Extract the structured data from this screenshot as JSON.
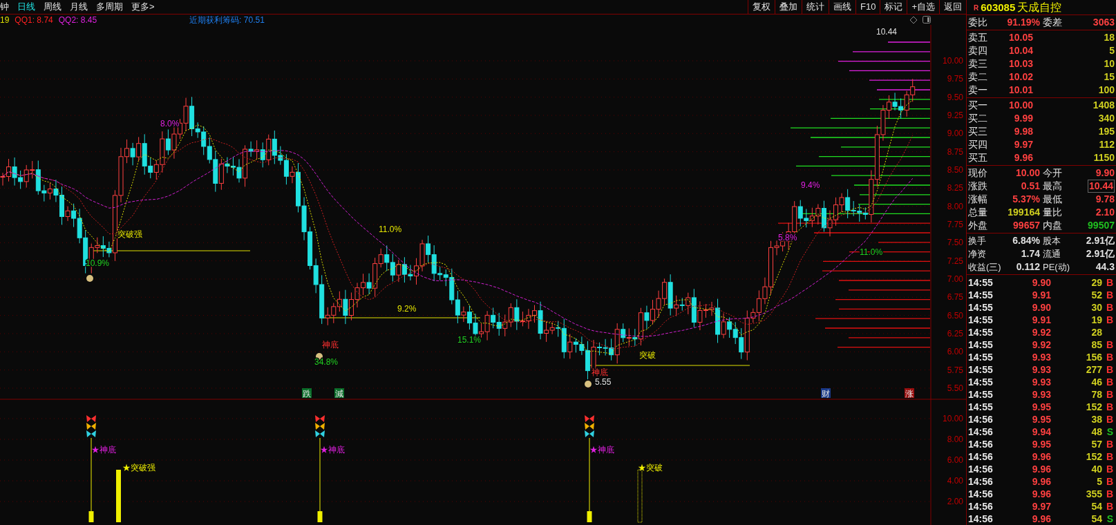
{
  "toolbar": {
    "period_tabs": [
      {
        "label": "钟",
        "selected": false
      },
      {
        "label": "日线",
        "selected": true
      },
      {
        "label": "周线",
        "selected": false
      },
      {
        "label": "月线",
        "selected": false
      },
      {
        "label": "多周期",
        "selected": false
      },
      {
        "label": "更多>",
        "selected": false
      }
    ],
    "buttons": [
      "复权",
      "叠加",
      "统计",
      "画线",
      "F10",
      "标记",
      "+自选",
      "返回"
    ]
  },
  "legend": [
    {
      "text": "19",
      "color": "#e0e000"
    },
    {
      "text": "QQ1: 8.74",
      "color": "#ff2020"
    },
    {
      "text": "QQ2: 8.45",
      "color": "#e020e0"
    },
    {
      "text": "近期获利筹码: 70.51",
      "color": "#1e7ff0"
    }
  ],
  "main_chart": {
    "y_ticks": [
      "10.00",
      "9.75",
      "9.50",
      "9.25",
      "9.00",
      "8.75",
      "8.50",
      "8.25",
      "8.00",
      "7.75",
      "7.50",
      "7.25",
      "7.00",
      "6.75",
      "6.50",
      "6.25",
      "6.00",
      "5.75",
      "5.50"
    ],
    "annotations": [
      {
        "text": "8.0%",
        "color": "#e020e0"
      },
      {
        "text": "突破强",
        "color": "#e8e800"
      },
      {
        "text": "10.9%",
        "color": "#20d020"
      },
      {
        "text": "11.0%",
        "color": "#e8e800"
      },
      {
        "text": "9.2%",
        "color": "#e8e800"
      },
      {
        "text": "15.1%",
        "color": "#20d020"
      },
      {
        "text": "神底",
        "color": "#ff3030"
      },
      {
        "text": "34.8%",
        "color": "#20d020"
      },
      {
        "text": "突破",
        "color": "#e8e800"
      },
      {
        "text": "神底",
        "color": "#ff3030"
      },
      {
        "text": "5.55",
        "color": "#e0e0e0"
      },
      {
        "text": "5.8%",
        "color": "#e020e0"
      },
      {
        "text": "9.4%",
        "color": "#e020e0"
      },
      {
        "text": "11.0%",
        "color": "#20d020"
      },
      {
        "text": "10.44",
        "color": "#e0e0e0"
      }
    ],
    "markers": [
      {
        "text": "跌",
        "color": "#0a6e2a"
      },
      {
        "text": "減",
        "color": "#0a6e2a"
      },
      {
        "text": "财",
        "color": "#1a3a8a"
      },
      {
        "text": "涨",
        "color": "#9a1010"
      }
    ]
  },
  "indicator_pane": {
    "y_ticks": [
      "10.00",
      "8.00",
      "6.00",
      "4.00",
      "2.00"
    ],
    "signals": [
      {
        "kind": "bottom",
        "label": "★神底",
        "color": "#e020e0"
      },
      {
        "kind": "solid_bar",
        "label": "★突破强",
        "color": "#f0f000"
      },
      {
        "kind": "bottom",
        "label": "★神底",
        "color": "#e020e0"
      },
      {
        "kind": "bottom",
        "label": "★神底",
        "color": "#e020e0"
      },
      {
        "kind": "dotted_bar",
        "label": "★突破",
        "color": "#f0f000"
      }
    ]
  },
  "quote_panel": {
    "badge": "R",
    "code": "603085",
    "name": "天成自控",
    "ratio": [
      {
        "label": "委比",
        "value": "91.19%"
      },
      {
        "label": "委差",
        "value": "3063"
      }
    ],
    "asks": [
      {
        "label": "卖五",
        "price": "10.05",
        "volume": "18"
      },
      {
        "label": "卖四",
        "price": "10.04",
        "volume": "5"
      },
      {
        "label": "卖三",
        "price": "10.03",
        "volume": "10"
      },
      {
        "label": "卖二",
        "price": "10.02",
        "volume": "15"
      },
      {
        "label": "卖一",
        "price": "10.01",
        "volume": "100"
      }
    ],
    "bids": [
      {
        "label": "买一",
        "price": "10.00",
        "volume": "1408"
      },
      {
        "label": "买二",
        "price": "9.99",
        "volume": "340"
      },
      {
        "label": "买三",
        "price": "9.98",
        "volume": "195"
      },
      {
        "label": "买四",
        "price": "9.97",
        "volume": "112"
      },
      {
        "label": "买五",
        "price": "9.96",
        "volume": "1150"
      }
    ],
    "stats": [
      [
        {
          "label": "现价",
          "value": "10.00",
          "color": "#ff4040",
          "highlighted": false
        },
        {
          "label": "今开",
          "value": "9.90",
          "color": "#ff4040",
          "highlighted": false
        }
      ],
      [
        {
          "label": "涨跌",
          "value": "0.51",
          "color": "#ff4040",
          "highlighted": false
        },
        {
          "label": "最高",
          "value": "10.44",
          "color": "#ff4040",
          "highlighted": true
        }
      ],
      [
        {
          "label": "涨幅",
          "value": "5.37%",
          "color": "#ff4040",
          "highlighted": false
        },
        {
          "label": "最低",
          "value": "9.78",
          "color": "#ff4040",
          "highlighted": false
        }
      ],
      [
        {
          "label": "总量",
          "value": "199164",
          "color": "#d0d020",
          "highlighted": false
        },
        {
          "label": "量比",
          "value": "2.10",
          "color": "#ff4040",
          "highlighted": false
        }
      ],
      [
        {
          "label": "外盘",
          "value": "99657",
          "color": "#ff4040",
          "highlighted": false
        },
        {
          "label": "内盘",
          "value": "99507",
          "color": "#20c020",
          "highlighted": false
        }
      ]
    ],
    "fundamentals": [
      [
        {
          "label": "换手",
          "value": "6.84%"
        },
        {
          "label": "股本",
          "value": "2.91亿"
        }
      ],
      [
        {
          "label": "净资",
          "value": "1.74"
        },
        {
          "label": "流通",
          "value": "2.91亿"
        }
      ],
      [
        {
          "label": "收益(三)",
          "value": "0.112"
        },
        {
          "label": "PE(动)",
          "value": "44.3"
        }
      ]
    ],
    "trades": [
      {
        "time": "14:55",
        "price": "9.90",
        "volume": "29",
        "side": "B",
        "color": "#ff3030"
      },
      {
        "time": "14:55",
        "price": "9.91",
        "volume": "52",
        "side": "B",
        "color": "#ff3030"
      },
      {
        "time": "14:55",
        "price": "9.90",
        "volume": "30",
        "side": "B",
        "color": "#ff3030"
      },
      {
        "time": "14:55",
        "price": "9.91",
        "volume": "19",
        "side": "B",
        "color": "#ff3030"
      },
      {
        "time": "14:55",
        "price": "9.92",
        "volume": "28"
      },
      {
        "time": "14:55",
        "price": "9.92",
        "volume": "85",
        "side": "B",
        "color": "#ff3030"
      },
      {
        "time": "14:55",
        "price": "9.93",
        "volume": "156",
        "side": "B",
        "color": "#ff3030"
      },
      {
        "time": "14:55",
        "price": "9.93",
        "volume": "277",
        "side": "B",
        "color": "#ff3030"
      },
      {
        "time": "14:55",
        "price": "9.93",
        "volume": "46",
        "side": "B",
        "color": "#ff3030"
      },
      {
        "time": "14:55",
        "price": "9.93",
        "volume": "78",
        "side": "B",
        "color": "#ff3030"
      },
      {
        "time": "14:55",
        "price": "9.95",
        "volume": "152",
        "side": "B",
        "color": "#ff3030"
      },
      {
        "time": "14:56",
        "price": "9.95",
        "volume": "38",
        "side": "B",
        "color": "#ff3030"
      },
      {
        "time": "14:56",
        "price": "9.94",
        "volume": "48",
        "side": "S",
        "color": "#20c020"
      },
      {
        "time": "14:56",
        "price": "9.95",
        "volume": "57",
        "side": "B",
        "color": "#ff3030"
      },
      {
        "time": "14:56",
        "price": "9.96",
        "volume": "152",
        "side": "B",
        "color": "#ff3030"
      },
      {
        "time": "14:56",
        "price": "9.96",
        "volume": "40",
        "side": "B",
        "color": "#ff3030"
      },
      {
        "time": "14:56",
        "price": "9.96",
        "volume": "5",
        "side": "B",
        "color": "#ff3030"
      },
      {
        "time": "14:56",
        "price": "9.96",
        "volume": "355",
        "side": "B",
        "color": "#ff3030"
      },
      {
        "time": "14:56",
        "price": "9.97",
        "volume": "54",
        "side": "B",
        "color": "#ff3030"
      },
      {
        "time": "14:56",
        "price": "9.96",
        "volume": "54",
        "side": "S",
        "color": "#20c020"
      }
    ]
  }
}
